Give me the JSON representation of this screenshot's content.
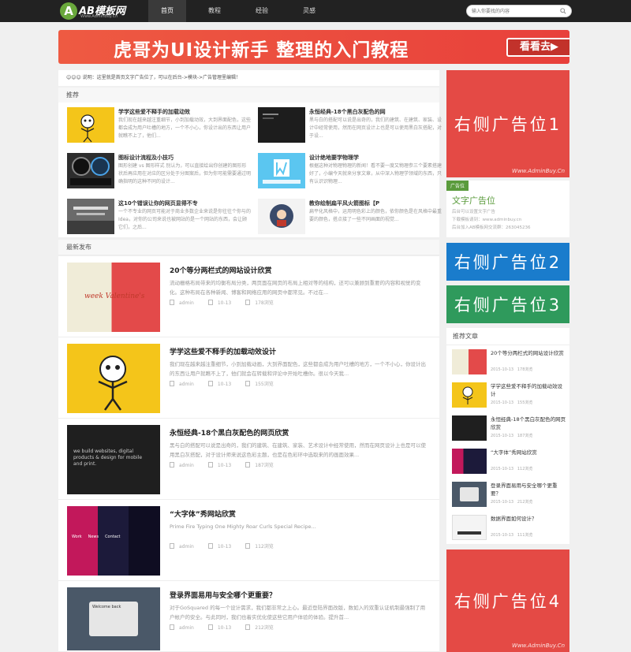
{
  "nav": {
    "logo_badge": "A",
    "logo_title": "AB模板网",
    "logo_sub": "Www.AdminBuy.Cn",
    "items": [
      {
        "label": "首页"
      },
      {
        "label": "教程"
      },
      {
        "label": "经验"
      },
      {
        "label": "灵感"
      }
    ],
    "search_placeholder": "输入你要找的内容"
  },
  "banner": {
    "text": "虎哥为UI设计新手 整理的入门教程",
    "button": "看看去▶"
  },
  "notice": "☺☺☺ 说明：这里就是首页文字广告位了，可以在后台->模块->广告管理里编辑！",
  "recommend": {
    "heading": "推荐",
    "items": [
      {
        "title": "学学这些爱不释手的加载动效",
        "desc": "我们现在越来越注重细节，小到加载动效，大到界面配色，这些都会成为用户吐槽的地方，一个不小心，你设计出的东西让用户就瞧不上了，他们..."
      },
      {
        "title": "永恒经典-18个黑白灰配色的网",
        "desc": "黑与白的搭配可以说是出奇的，我们的建筑、在建筑、家装、设计中经常使用，然而在网页设计上也是可以使用黑白灰搭配，对于设..."
      },
      {
        "title": "图标设计流程及小技巧",
        "desc": "图形创建 vs 图形样式 别认为，可以直接绘出你创建的图形形状后再应用在对应的区分处于分图案后，但为你可能需要通过明确指明的这种不同的设计..."
      },
      {
        "title": "设计绝地要学物理学",
        "desc": "根据这种对物理物理的新闻！看不要一度又物理参三个要素搭建好了，小编今天就来分享文章，从中深入物理学领域的东西，只有认识识物理..."
      },
      {
        "title": "这10个错误让你的网页显得不专",
        "desc": "一个不专业的网页可能对于商业多数企业来说是你往往个你与的 Idea，对你的公司来说也被网站的是一个网站的东西，会让顾它们，之后..."
      },
      {
        "title": "教你绘制扁平风火箭图标【P",
        "desc": "扁平化风格中，运用明色彩上的颜色，依你颜色是在风格中最重要的颜色，搭点接了一些不同画面的视觉..."
      }
    ]
  },
  "latest": {
    "heading": "最新发布",
    "posts": [
      {
        "title": "20个等分两栏式的网站设计欣赏",
        "desc": "流动栅格布局带来的均衡布局分类，两页面在网页的布局上相对等的结构，还可以兼顾到重要的内容和视觉的变化。这种布局在各种新闻、博客和网络应用的网页中都常见。不过在...",
        "author": "admin",
        "date": "10-13",
        "views": "178浏览",
        "thumb_text": "week   Valentine's"
      },
      {
        "title": "学学这些爱不释手的加载动效设计",
        "desc": "我们现在越来越注重细节，小到加载动画，大到界面配色，这些都会成为用户吐槽的地方，一个不小心，你设计出的东西让用户就瞧不上了，他们就会在转载和评论中开始吐槽你。很以今天我...",
        "author": "admin",
        "date": "10-13",
        "views": "155浏览",
        "thumb_text": ""
      },
      {
        "title": "永恒经典-18个黑白灰配色的网页欣赏",
        "desc": "黑与白的搭配可以说是出奇的，我们的建筑、在建筑、家装、艺术设计中经常使用，然而在网页设计上也是可以使用黑白灰搭配，对于设计师来说这色彩主题，也是在色彩环中选取来的的画面效果...",
        "author": "admin",
        "date": "10-13",
        "views": "187浏览",
        "thumb_text": "we build websites, digital products & design for mobile and print."
      },
      {
        "title": "“大字体”秀网站欣赏",
        "desc": "Prime Fire Typing One Mighty Roar Curls Special Recipe...",
        "author": "admin",
        "date": "10-13",
        "views": "112浏览",
        "thumb_text": "Work     News     Contact"
      },
      {
        "title": "登录界面易用与安全哪个更重要？",
        "desc": "对于GoSquared 的每一个设计需求，我们都非常之上心。最近登陆界面改版，数如入的双重认证机制最强制了用户帐户的安全。与此同时，我们也着实优化使这些它用户体验的体验。提升首...",
        "author": "admin",
        "date": "10-13",
        "views": "212浏览",
        "thumb_text": "Welcome back"
      }
    ]
  },
  "sidebar": {
    "ad1": "右侧广告位1",
    "ad_watermark": "Www.AdminBuy.Cn",
    "text_ad": {
      "tag": "广告位",
      "title": "文字广告位",
      "lines": [
        "后台可以设置文字广告",
        "下载模板请到：www.adminbuy.cn",
        "后台加入AB模板网交流群：263045236"
      ]
    },
    "ad2": "右侧广告位2",
    "ad3": "右侧广告位3",
    "hot_heading": "推荐文章",
    "hot": [
      {
        "title": "20个等分两栏式的网站设计欣赏",
        "date": "2015-10-13",
        "views": "178浏览"
      },
      {
        "title": "学学这些爱不释手的加载动效设计",
        "date": "2015-10-13",
        "views": "155浏览"
      },
      {
        "title": "永恒经典-18个黑白灰配色的网页欣赏",
        "date": "2015-10-13",
        "views": "187浏览"
      },
      {
        "title": "“大字体”秀网站欣赏",
        "date": "2015-10-13",
        "views": "112浏览"
      },
      {
        "title": "登录界面易用与安全哪个更重要？",
        "date": "2015-10-13",
        "views": "212浏览"
      },
      {
        "title": "数据界面如何设计？",
        "date": "2015-10-13",
        "views": "111浏览"
      }
    ],
    "ad4": "右侧广告位4"
  },
  "colors": {
    "nav_bg": "#222222",
    "banner": "#e8403b",
    "ad_red": "#e44a45",
    "ad_blue": "#1a7ccc",
    "ad_green": "#2f9a5c",
    "accent_green": "#5a9b3c"
  }
}
